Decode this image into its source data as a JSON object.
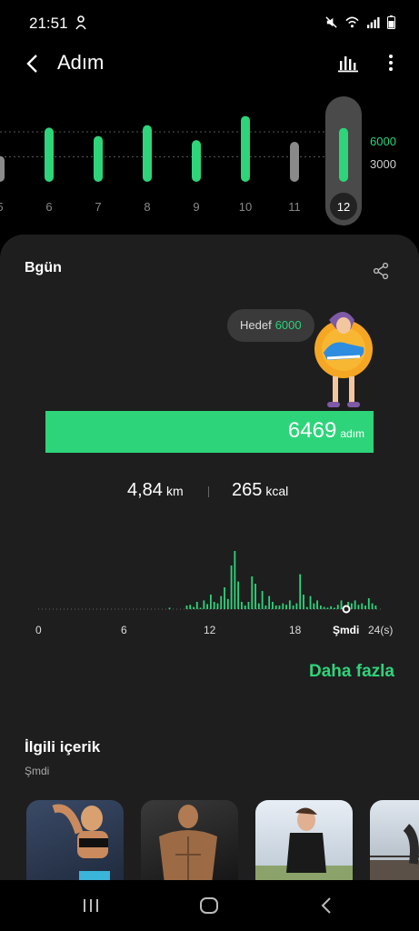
{
  "status_bar": {
    "time": "21:51"
  },
  "header": {
    "title": "Adım"
  },
  "weekly": {
    "days": [
      {
        "label": "5",
        "value": 3100,
        "reached": false
      },
      {
        "label": "6",
        "value": 6500,
        "reached": true
      },
      {
        "label": "7",
        "value": 5500,
        "reached": true
      },
      {
        "label": "8",
        "value": 6800,
        "reached": true
      },
      {
        "label": "9",
        "value": 5000,
        "reached": true
      },
      {
        "label": "10",
        "value": 7900,
        "reached": true
      },
      {
        "label": "11",
        "value": 4800,
        "reached": false
      },
      {
        "label": "12",
        "value": 6469,
        "reached": true,
        "selected": true
      }
    ],
    "goal_label": "6000",
    "half_label": "3000"
  },
  "card": {
    "title": "Bgün",
    "goal_label": "Hedef",
    "goal_value": "6000",
    "steps": "6469",
    "steps_unit": "adım",
    "progress": 1.0,
    "distance": "4,84",
    "distance_unit": "km",
    "calories": "265",
    "calories_unit": "kcal",
    "hourly_ticks": [
      "0",
      "6",
      "12",
      "18",
      "Şmdi",
      "24(s)"
    ],
    "more_link": "Daha fazla"
  },
  "related": {
    "title": "İlgili içerik",
    "subtitle": "Şmdi"
  },
  "colors": {
    "accent": "#2ed47a",
    "inactive": "#8a8a8a",
    "card": "#1e1e1e"
  }
}
